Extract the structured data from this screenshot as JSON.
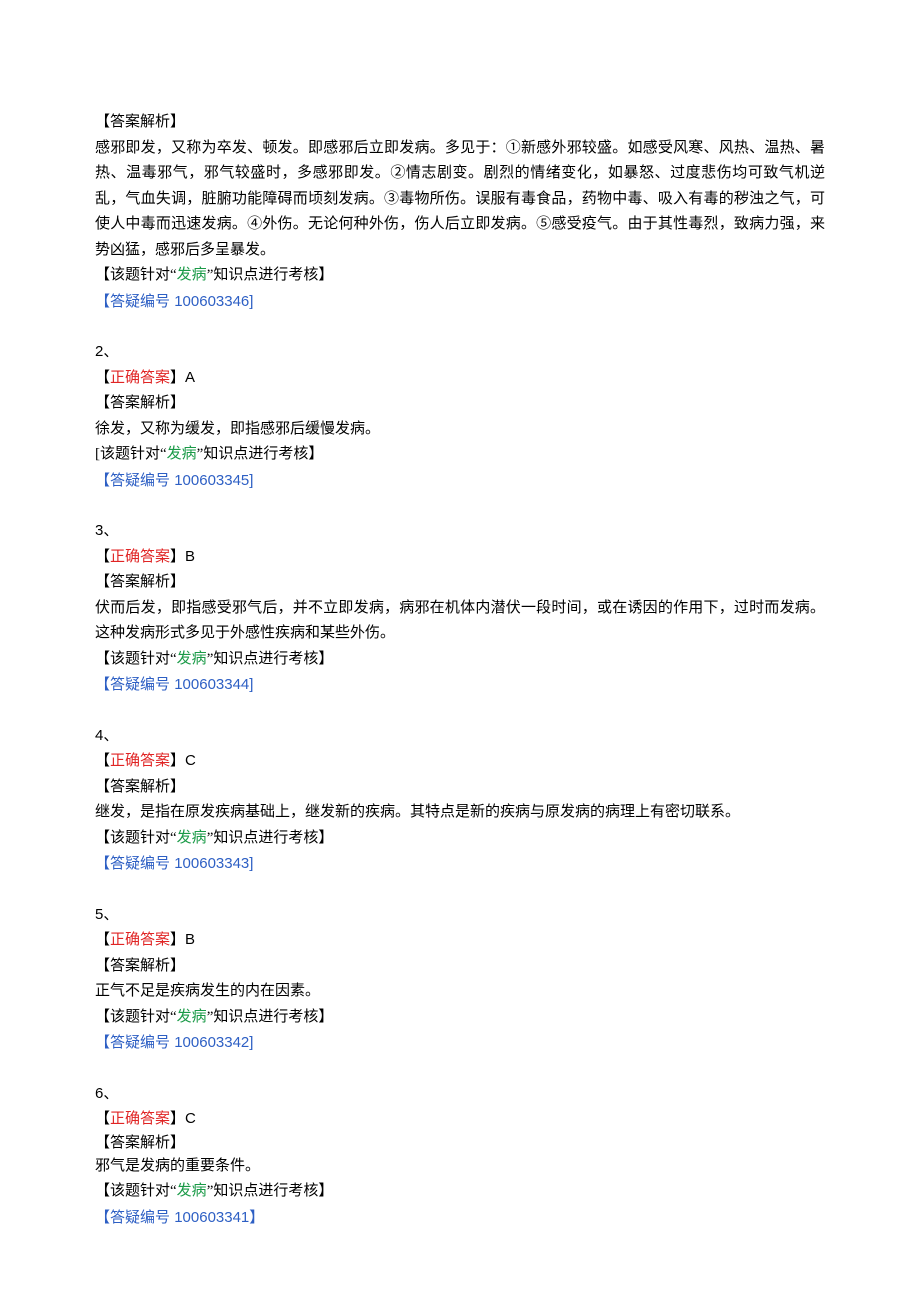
{
  "q1": {
    "analysis_label": "【答案解析】",
    "analysis_body": "感邪即发，又称为卒发、顿发。即感邪后立即发病。多见于：①新感外邪较盛。如感受风寒、风热、温热、暑热、温毒邪气，邪气较盛时，多感邪即发。②情志剧变。剧烈的情绪变化，如暴怒、过度悲伤均可致气机逆乱，气血失调，脏腑功能障碍而顷刻发病。③毒物所伤。误服有毒食品，药物中毒、吸入有毒的秽浊之气，可使人中毒而迅速发病。④外伤。无论何种外伤，伤人后立即发病。⑤感受疫气。由于其性毒烈，致病力强，来势凶猛，感邪后多呈暴发。",
    "topic_prefix": "【该题针对“",
    "topic_term": "发病",
    "topic_suffix": "”知识点进行考核】",
    "query_prefix": "【",
    "query_label": "答疑编号",
    "query_id": " 100603346]"
  },
  "q2": {
    "number": "2、",
    "correct_prefix": "【",
    "correct_label": "正确答案",
    "correct_suffix": "】",
    "answer": "A",
    "analysis_label": "【答案解析】",
    "analysis_body": "徐发，又称为缓发，即指感邪后缓慢发病。",
    "topic_prefix": "[该题针对“",
    "topic_term": "发病",
    "topic_suffix": "”知识点进行考核】",
    "query_prefix": "【",
    "query_label": "答疑编号",
    "query_id": " 100603345]"
  },
  "q3": {
    "number": "3、",
    "correct_prefix": "【",
    "correct_label": "正确答案",
    "correct_suffix": "】",
    "answer": "B",
    "analysis_label": "【答案解析】",
    "analysis_body": "伏而后发，即指感受邪气后，并不立即发病，病邪在机体内潜伏一段时间，或在诱因的作用下，过时而发病。这种发病形式多见于外感性疾病和某些外伤。",
    "topic_prefix": "【该题针对“",
    "topic_term": "发病",
    "topic_suffix": "”知识点进行考核】",
    "query_prefix": "【",
    "query_label": "答疑编号",
    "query_id": " 100603344]"
  },
  "q4": {
    "number": "4、",
    "correct_prefix": "【",
    "correct_label": "正确答案",
    "correct_suffix": "】",
    "answer": "C",
    "analysis_label": "【答案解析】",
    "analysis_body": "继发，是指在原发疾病基础上，继发新的疾病。其特点是新的疾病与原发病的病理上有密切联系。",
    "topic_prefix": "【该题针对“",
    "topic_term": "发病",
    "topic_suffix": "”知识点进行考核】",
    "query_prefix": "【",
    "query_label": "答疑编号",
    "query_id": " 100603343]"
  },
  "q5": {
    "number": "5、",
    "correct_prefix": "【",
    "correct_label": "正确答案",
    "correct_suffix": "】",
    "answer": "B",
    "analysis_label": "【答案解析】",
    "analysis_body": "正气不足是疾病发生的内在因素。",
    "topic_prefix": "【该题针对“",
    "topic_term": "发病",
    "topic_suffix": "”知识点进行考核】",
    "query_prefix": "【",
    "query_label": "答疑编号",
    "query_id": " 100603342]"
  },
  "q6": {
    "number": "6、",
    "correct_prefix": "【",
    "correct_label": "正确答案",
    "correct_suffix": "】",
    "answer": "C",
    "analysis_label": "【答案解析】",
    "analysis_body": "邪气是发病的重要条件。",
    "topic_prefix": "【该题针对“",
    "topic_term": "发病",
    "topic_suffix": "”知识点进行考核】",
    "query_prefix": "【",
    "query_label": "答疑编号",
    "query_id": " 100603341】"
  }
}
